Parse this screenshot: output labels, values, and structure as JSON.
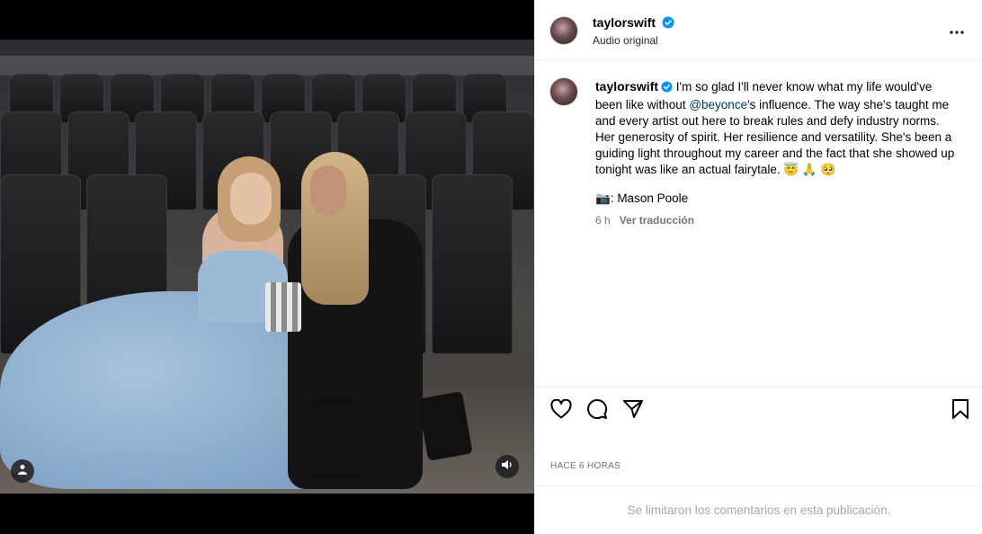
{
  "post": {
    "author": {
      "username": "taylorswift",
      "verified": true,
      "audio_label": "Audio original"
    },
    "caption": {
      "username": "taylorswift",
      "text_before_mention": "I'm so glad I'll never know what my life would've been like without ",
      "mention": "@beyonce",
      "text_after_mention": "'s influence. The way she's taught me and every artist out here to break rules and defy industry norms. Her generosity of spirit. Her resilience and versatility. She's been a guiding light throughout my career and the fact that she showed up tonight was like an actual fairytale. ",
      "emojis": "😇 🙏 🥺",
      "credit_emoji": "📷",
      "credit_text": ": Mason Poole"
    },
    "meta": {
      "age": "6 h",
      "translate_label": "Ver traducción"
    },
    "actions": {
      "like_icon": "heart-icon",
      "comment_icon": "comment-icon",
      "share_icon": "send-icon",
      "save_icon": "bookmark-icon"
    },
    "posted_label": "HACE 6 HORAS",
    "comments_limited": "Se limitaron los comentarios en esta publicación."
  },
  "media": {
    "tag_icon": "user-tag-icon",
    "audio_icon": "speaker-icon"
  },
  "colors": {
    "link": "#00376b",
    "verified": "#0095f6",
    "muted": "#737373",
    "border": "#efefef"
  }
}
